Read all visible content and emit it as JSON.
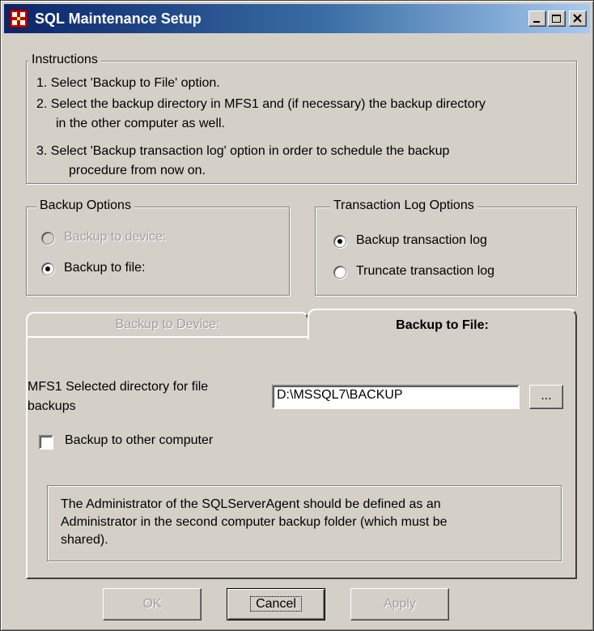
{
  "window": {
    "title": "SQL Maintenance Setup",
    "controls": [
      "minimize",
      "maximize",
      "close"
    ]
  },
  "instructions": {
    "legend": "Instructions",
    "lines": [
      "1. Select 'Backup to File' option.",
      "2. Select the backup directory in MFS1 and (if necessary) the backup directory",
      "in the other computer as well.",
      "3. Select 'Backup transaction log' option in order to schedule the backup",
      "procedure from now on."
    ]
  },
  "backup_options": {
    "legend": "Backup Options",
    "items": [
      {
        "label": "Backup to device:",
        "selected": false,
        "enabled": false
      },
      {
        "label": "Backup to file:",
        "selected": true,
        "enabled": true
      }
    ]
  },
  "transaction_log_options": {
    "legend": "Transaction Log Options",
    "items": [
      {
        "label": "Backup transaction log",
        "selected": true
      },
      {
        "label": "Truncate transaction log",
        "selected": false
      }
    ]
  },
  "tabs": [
    {
      "label": "Backup to Device:",
      "active": false,
      "enabled": false
    },
    {
      "label": "Backup to File:",
      "active": true,
      "enabled": true
    }
  ],
  "file_tab": {
    "directory_label_line1": "MFS1 Selected directory for file",
    "directory_label_line2": "backups",
    "directory_value": "D:\\MSSQL7\\BACKUP",
    "browse_label": "...",
    "other_computer_label": "Backup to other computer",
    "other_computer_checked": false,
    "note_lines": [
      "The Administrator of the SQLServerAgent should be defined as an",
      "Administrator in the second computer backup folder (which must be",
      "shared)."
    ]
  },
  "buttons": {
    "ok": "OK",
    "cancel": "Cancel",
    "apply": "Apply"
  },
  "colors": {
    "title_start": "#0a246a",
    "title_end": "#a6caf0",
    "face": "#d4d0c8"
  }
}
